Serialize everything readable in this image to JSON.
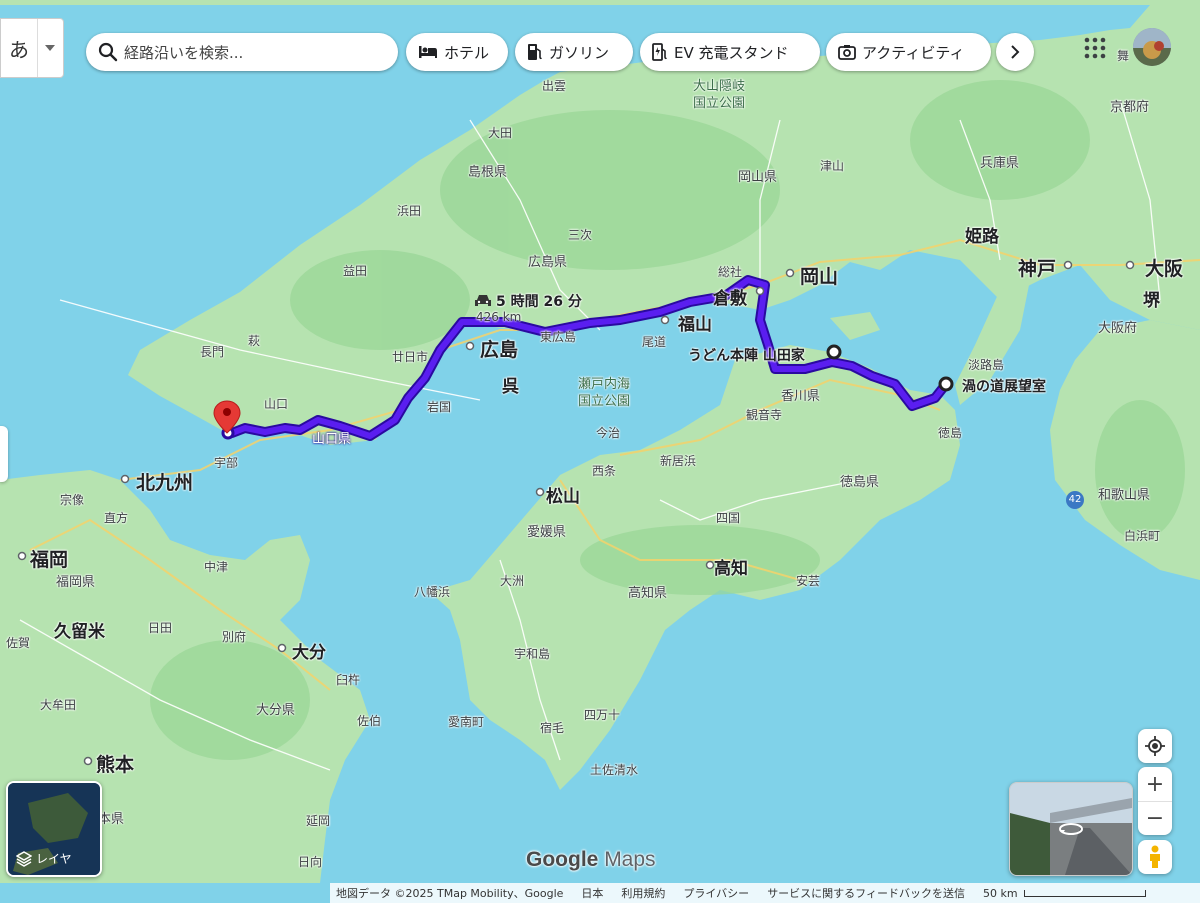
{
  "toolbar": {
    "ime_char": "あ",
    "search_placeholder": "経路沿いを検索...",
    "chips": [
      {
        "label": "ホテル",
        "icon": "bed-icon"
      },
      {
        "label": "ガソリン",
        "icon": "gas-station-icon"
      },
      {
        "label": "EV 充電スタンド",
        "icon": "ev-charger-icon"
      },
      {
        "label": "アクティビティ",
        "icon": "camera-icon"
      }
    ],
    "avatar_partial_text": "舞"
  },
  "route": {
    "duration": "5 時間 26 分",
    "distance": "426 km",
    "start": "渦の道展望室",
    "waypoint": "うどん本陣 山田家",
    "route_color": "#4a12d8",
    "destination_color": "#e53935"
  },
  "places": {
    "izumo": "出雲",
    "daisen_park": "大山隠岐\n国立公園",
    "kyoto": "京都府",
    "shimane": "島根県",
    "ota": "大田",
    "tsuyama": "津山",
    "hyogo": "兵庫県",
    "okayama_pref": "岡山県",
    "himeji": "姫路",
    "hamada": "浜田",
    "miyoshi": "三次",
    "masuda": "益田",
    "hiroshima_pref": "広島県",
    "kobe": "神戸",
    "osaka": "大阪",
    "sakai": "堺",
    "soja": "総社",
    "okayama": "岡山",
    "kurashiki": "倉敷",
    "fukuyama": "福山",
    "higashihiroshima": "東広島",
    "onomichi": "尾道",
    "osaka_pref": "大阪府",
    "hagi": "萩",
    "nagato": "長門",
    "hatsukaichi": "廿日市",
    "hiroshima": "広島",
    "kure": "呉",
    "yamaguchi": "山口",
    "iwakuni": "岩国",
    "setonaikai": "瀬戸内海\n国立公園",
    "awaji": "淡路島",
    "kagawa": "香川県",
    "kanonji": "観音寺",
    "yamaguchi_pref": "山口県",
    "imabari": "今治",
    "tokushima": "徳島",
    "ube": "宇部",
    "kitakyushu": "北九州",
    "saijo": "西条",
    "niihama": "新居浜",
    "tokushima_pref": "徳島県",
    "wakayama_pref": "和歌山県",
    "munakata": "宗像",
    "matsuyama": "松山",
    "nogata": "直方",
    "ehime": "愛媛県",
    "shikoku": "四国",
    "fukuoka": "福岡",
    "shirahama": "白浜町",
    "nakatsu": "中津",
    "yawatahama": "八幡浜",
    "ozu": "大洲",
    "kochi": "高知",
    "aki": "安芸",
    "fukuoka_pref": "福岡県",
    "kochi_pref": "高知県",
    "saga": "佐賀",
    "kurume": "久留米",
    "hita": "日田",
    "beppu": "別府",
    "oita": "大分",
    "uwajima": "宇和島",
    "usuki": "臼杵",
    "omuta": "大牟田",
    "oita_pref": "大分県",
    "ainan": "愛南町",
    "sukumo": "宿毛",
    "shimanto": "四万十",
    "saiki": "佐伯",
    "kumamoto": "熊本",
    "tosashimizu": "土佐清水",
    "kumamoto_pref": "本県",
    "nobeoka": "延岡",
    "hyuga": "日向",
    "route42": "42"
  },
  "controls": {
    "layer_label": "レイヤ",
    "zoom_in": "+",
    "zoom_out": "−"
  },
  "attribution": {
    "logo_google": "Google",
    "logo_maps": "Maps",
    "items": [
      "地図データ ©2025 TMap Mobility、Google",
      "日本",
      "利用規約",
      "プライバシー",
      "サービスに関するフィードバックを送信"
    ],
    "scale_label": "50 km"
  }
}
